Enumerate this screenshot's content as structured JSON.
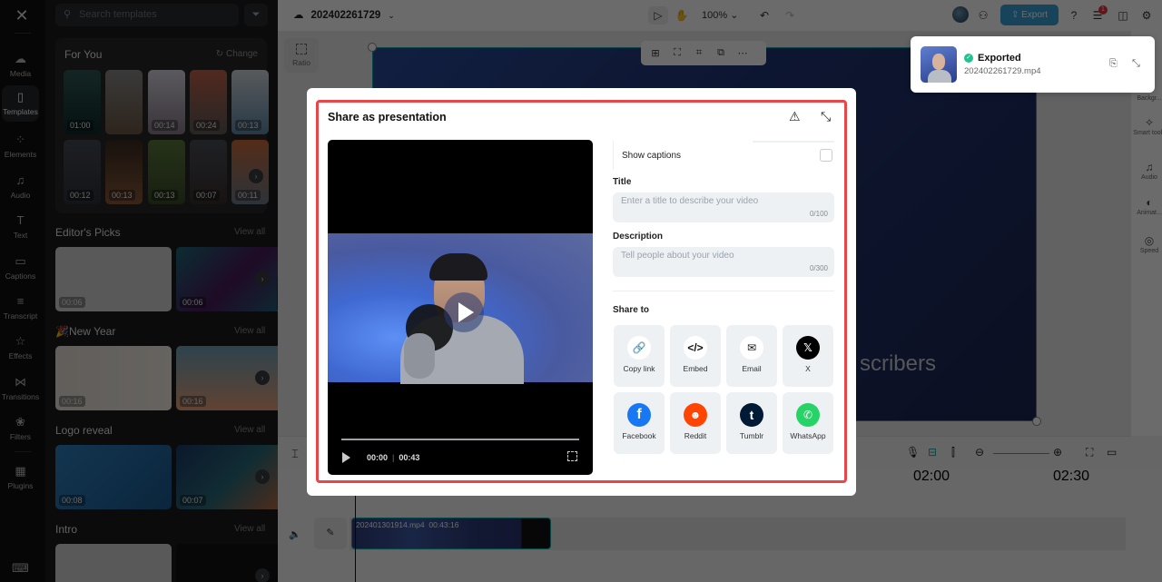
{
  "left_rail": {
    "logo": "CapCut",
    "items": [
      {
        "label": "Media",
        "icon": "cloud-upload-icon"
      },
      {
        "label": "Templates",
        "icon": "templates-icon",
        "active": true
      },
      {
        "label": "Elements",
        "icon": "elements-icon"
      },
      {
        "label": "Audio",
        "icon": "music-note-icon"
      },
      {
        "label": "Text",
        "icon": "text-icon"
      },
      {
        "label": "Captions",
        "icon": "captions-icon"
      },
      {
        "label": "Transcript",
        "icon": "transcript-icon"
      },
      {
        "label": "Effects",
        "icon": "effects-icon"
      },
      {
        "label": "Transitions",
        "icon": "transitions-icon"
      },
      {
        "label": "Filters",
        "icon": "filters-icon"
      },
      {
        "label": "Plugins",
        "icon": "plugins-icon"
      }
    ],
    "keyboard_icon": "keyboard-icon"
  },
  "templates_panel": {
    "search_placeholder": "Search templates",
    "for_you": {
      "title": "For You",
      "change_label": "Change",
      "durations_row1": [
        "01:00",
        "",
        "00:14",
        "00:24",
        "00:13"
      ],
      "durations_row2": [
        "00:12",
        "00:13",
        "00:13",
        "00:07",
        "00:11"
      ]
    },
    "sections": [
      {
        "title": "Editor's Picks",
        "view_all": "View all",
        "durations": [
          "00:06",
          "00:06"
        ]
      },
      {
        "title": "🎉New Year",
        "view_all": "View all",
        "durations": [
          "00:16",
          "00:16"
        ]
      },
      {
        "title": "Logo reveal",
        "view_all": "View all",
        "durations": [
          "00:08",
          "00:07"
        ]
      },
      {
        "title": "Intro",
        "view_all": "View all",
        "durations": []
      }
    ]
  },
  "topbar": {
    "project_name": "202402261729",
    "zoom": "100%",
    "export_label": "Export",
    "notification_count": "1"
  },
  "canvas": {
    "ratio_label": "Ratio",
    "subtitle_text": "scribers"
  },
  "right_rail": {
    "items": [
      {
        "label": "Backgr..."
      },
      {
        "label": "Smart tools"
      },
      {
        "label": "Audio"
      },
      {
        "label": "Animat..."
      },
      {
        "label": "Speed"
      }
    ]
  },
  "timeline": {
    "ruler": [
      "02:00",
      "02:30"
    ],
    "clip_name": "202401301914.mp4",
    "clip_duration": "00:43:16"
  },
  "toast": {
    "status": "Exported",
    "filename": "202402261729.mp4"
  },
  "modal": {
    "title": "Share as presentation",
    "player": {
      "current_time": "00:00",
      "total_time": "00:43"
    },
    "show_captions_label": "Show captions",
    "show_captions_checked": false,
    "title_label": "Title",
    "title_placeholder": "Enter a title to describe your video",
    "title_value": "",
    "title_count": "0/100",
    "description_label": "Description",
    "description_placeholder": "Tell people about your video",
    "description_value": "",
    "description_count": "0/300",
    "share_to_label": "Share to",
    "share_targets": [
      {
        "label": "Copy link",
        "icon": "link-icon",
        "color": "#ffffff"
      },
      {
        "label": "Embed",
        "icon": "code-icon",
        "color": "#ffffff"
      },
      {
        "label": "Email",
        "icon": "mail-icon",
        "color": "#ffffff"
      },
      {
        "label": "X",
        "icon": "x-logo-icon",
        "color": "#000000"
      },
      {
        "label": "Facebook",
        "icon": "facebook-icon",
        "color": "#1877f2"
      },
      {
        "label": "Reddit",
        "icon": "reddit-icon",
        "color": "#ff4500"
      },
      {
        "label": "Tumblr",
        "icon": "tumblr-icon",
        "color": "#001935"
      },
      {
        "label": "WhatsApp",
        "icon": "whatsapp-icon",
        "color": "#25d366"
      }
    ]
  }
}
